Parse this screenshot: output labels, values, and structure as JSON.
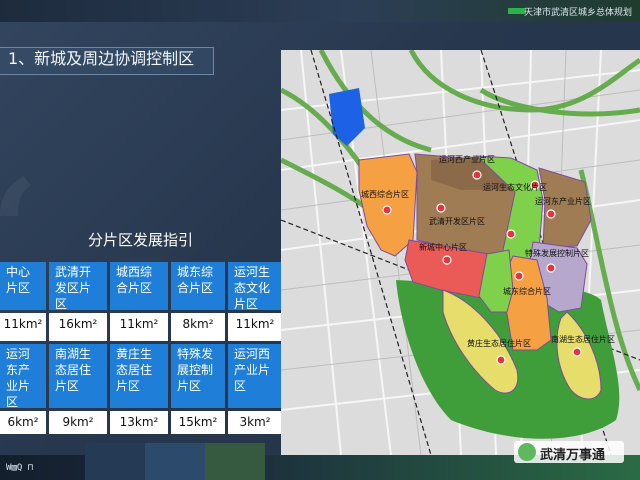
{
  "header": {
    "title": "天津市武清区城乡总体规划"
  },
  "section": {
    "title": "1、新城及周边协调控制区"
  },
  "table_title": "分片区发展指引",
  "table": {
    "row1_names": [
      "中心片区",
      "武清开发区片区",
      "城西综合片区",
      "城东综合片区",
      "运河生态文化片区"
    ],
    "row1_values": [
      "11km²",
      "16km²",
      "11km²",
      "8km²",
      "11km²"
    ],
    "row2_names": [
      "运河东产业片区",
      "南湖生态居住片区",
      "黄庄生态居住片区",
      "特殊发展控制片区",
      "运河西产业片区"
    ],
    "row2_values": [
      "6km²",
      "9km²",
      "13km²",
      "15km²",
      "3km²"
    ]
  },
  "map": {
    "zones": [
      "运河西产业片区",
      "运河生态文化片区",
      "城西综合片区",
      "运河东产业片区",
      "武清开发区片区",
      "新城中心片区",
      "特殊发展控制片区",
      "城东综合片区",
      "黄庄生态居住片区",
      "南湖生态居住片区"
    ],
    "zone_colors": {
      "orange": "#f5a043",
      "brown": "#a07c55",
      "red": "#ea5a56",
      "green": "#7fd04a",
      "lilac": "#b5a8cc",
      "yellow": "#e6dd6b",
      "dark_green": "#3f9e3a",
      "marker": "#e8333a"
    }
  },
  "footer": {
    "logo_text": "W▧Q ⊓",
    "watermark": "武清万事通"
  }
}
